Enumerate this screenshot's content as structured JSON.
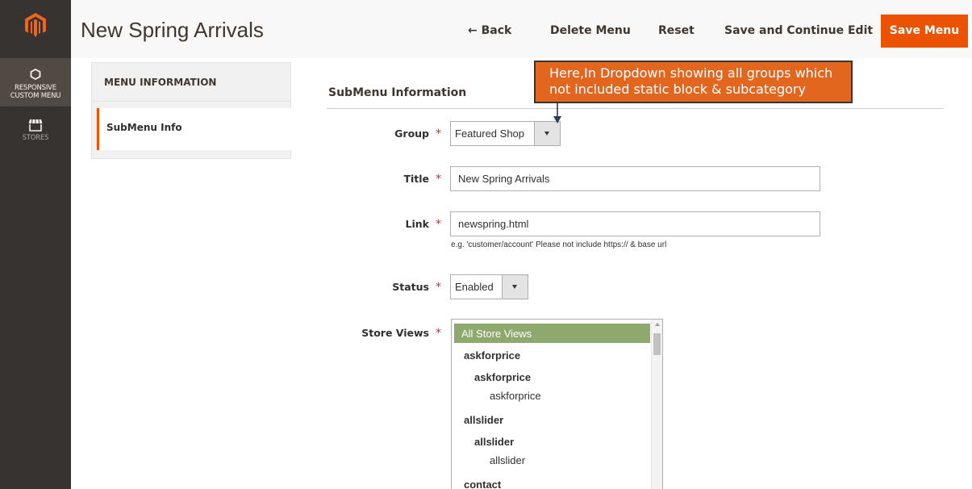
{
  "sidebar": {
    "items": [
      {
        "label_line1": "RESPONSIVE",
        "label_line2": "CUSTOM MENU",
        "icon": "hexagon-icon"
      },
      {
        "label": "STORES",
        "icon": "store-icon"
      }
    ]
  },
  "header": {
    "title": "New Spring Arrivals",
    "back_label": "← Back",
    "delete_label": "Delete Menu",
    "reset_label": "Reset",
    "save_continue_label": "Save and Continue Edit",
    "save_label": "Save Menu"
  },
  "tabs": {
    "heading": "MENU INFORMATION",
    "items": [
      {
        "label": "SubMenu Info"
      }
    ]
  },
  "form": {
    "section_title": "SubMenu Information",
    "required_mark": "*",
    "group": {
      "label": "Group",
      "value": "Featured Shop"
    },
    "title": {
      "label": "Title",
      "value": "New Spring Arrivals"
    },
    "link": {
      "label": "Link",
      "value": "newspring.html",
      "note": "e.g. 'customer/account' Please not include https:// & base url"
    },
    "status": {
      "label": "Status",
      "value": "Enabled"
    },
    "store_views": {
      "label": "Store Views",
      "options": [
        {
          "text": "All Store Views",
          "level": 0,
          "selected": true
        },
        {
          "text": "askforprice",
          "level": 1
        },
        {
          "text": "askforprice",
          "level": 2
        },
        {
          "text": "askforprice",
          "level": 3
        },
        {
          "text": "allslider",
          "level": 1
        },
        {
          "text": "allslider",
          "level": 2
        },
        {
          "text": "allslider",
          "level": 3
        },
        {
          "text": "contact",
          "level": 1
        }
      ]
    }
  },
  "annotation": {
    "text": "Here,In Dropdown showing  all groups which not included static block & subcategory"
  },
  "colors": {
    "sidebar_bg": "#373330",
    "accent": "#eb5202",
    "selected_option": "#8ea96e",
    "callout": "#e3661f"
  }
}
